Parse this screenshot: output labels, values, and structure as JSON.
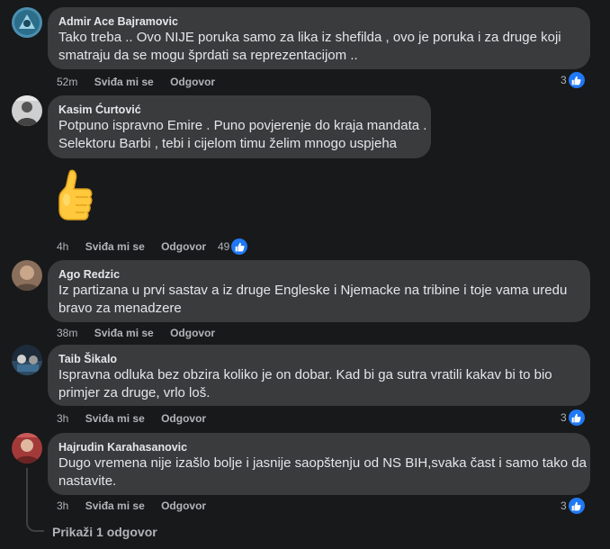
{
  "comments": [
    {
      "author": "Admir Ace Bajramovic",
      "lines": [
        "Tako treba .. Ovo NIJE poruka samo za lika iz shefilda , ovo je poruka i za druge koji",
        "smatraju da se mogu šprdati sa reprezentacijom .."
      ],
      "time": "52m",
      "like_label": "Sviđa mi se",
      "reply_label": "Odgovor",
      "reactions": "3"
    },
    {
      "author": "Kasim Ćurtović",
      "lines": [
        "Potpuno ispravno Emire . Puno povjerenje do kraja mandata .",
        "Selektoru Barbi , tebi i cijelom timu želim mnogo uspjeha"
      ],
      "sticker": "thumbs-up",
      "time": "4h",
      "like_label": "Sviđa mi se",
      "reply_label": "Odgovor",
      "reactions": "49"
    },
    {
      "author": "Ago Redzic",
      "lines": [
        "Iz partizana u prvi sastav a iz druge Engleske i Njemacke na tribine i toje vama uredu",
        "bravo za menadzere"
      ],
      "time": "38m",
      "like_label": "Sviđa mi se",
      "reply_label": "Odgovor"
    },
    {
      "author": "Taib Šikalo",
      "lines": [
        "Ispravna odluka bez obzira koliko je on dobar. Kad bi ga sutra vratili kakav bi to bio",
        "primjer za druge, vrlo loš."
      ],
      "time": "3h",
      "like_label": "Sviđa mi se",
      "reply_label": "Odgovor",
      "reactions": "3"
    },
    {
      "author": "Hajrudin Karahasanovic",
      "lines": [
        "Dugo vremena nije izašlo bolje i jasnije saopštenju od NS BIH,svaka čast i samo tako da",
        "nastavite."
      ],
      "time": "3h",
      "like_label": "Sviđa mi se",
      "reply_label": "Odgovor",
      "reactions": "3"
    }
  ],
  "show_replies": "Prikaži 1 odgovor",
  "colors": {
    "background": "#18191a",
    "bubble": "#3a3b3c",
    "text_primary": "#e4e6eb",
    "text_secondary": "#b0b3b8",
    "like_blue": "#2078f4"
  }
}
